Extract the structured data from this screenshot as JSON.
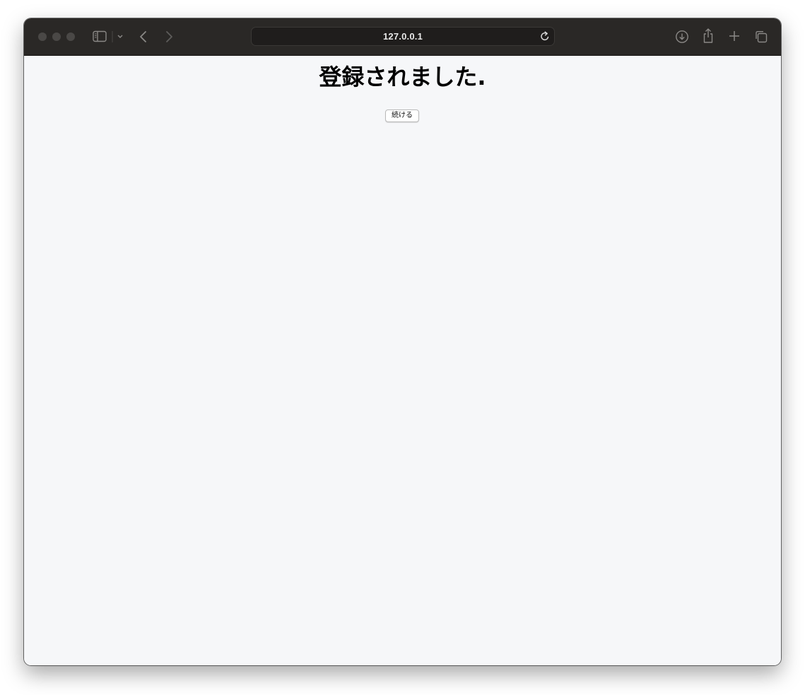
{
  "browser": {
    "url": "127.0.0.1",
    "icons": {
      "sidebar": "sidebar-icon",
      "sidebar_menu": "chevron-down-icon",
      "back": "chevron-left-icon",
      "forward": "chevron-right-icon",
      "reload": "reload-icon",
      "downloads": "download-icon",
      "share": "share-icon",
      "new_tab": "plus-icon",
      "tab_overview": "tabs-icon"
    },
    "colors": {
      "toolbar": "#2a2826",
      "page_background": "#f6f7f9"
    }
  },
  "page": {
    "heading": "登録されました.",
    "continue_label": "続ける"
  }
}
